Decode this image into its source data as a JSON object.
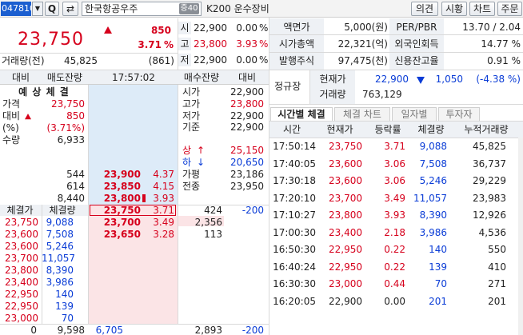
{
  "toolbar": {
    "code": "047810",
    "name": "한국항공우주",
    "badge": "증40",
    "index_label": "K200 운수장비",
    "btn_opinion": "의견",
    "btn_quote": "시황",
    "btn_chart": "차트",
    "btn_order": "주문",
    "search_glyph": "Q",
    "refresh_glyph": "⇄"
  },
  "summary": {
    "price": "23,750",
    "change": "850",
    "change_pct": "3.71",
    "pct_sign": "%",
    "volume_label": "거래량(전)",
    "volume": "45,825",
    "volume_prev": "(861)",
    "ohl": [
      {
        "label": "시",
        "value": "22,900",
        "pct": "0.00",
        "unit": "%"
      },
      {
        "label": "고",
        "value": "23,800",
        "pct": "3.93",
        "unit": "%"
      },
      {
        "label": "저",
        "value": "22,900",
        "pct": "0.00",
        "unit": "%"
      }
    ]
  },
  "info": {
    "rows": [
      {
        "l1": "액면가",
        "v1": "5,000(원)",
        "l2": "PER/PBR",
        "v2": "13.70 / 2.04"
      },
      {
        "l1": "시가총액",
        "v1": "22,321(억)",
        "l2": "외국인회득",
        "v2": "14.77 %"
      },
      {
        "l1": "발행주식",
        "v1": "97,475(천)",
        "l2": "신용잔고율",
        "v2": "0.91 %"
      }
    ],
    "regular_label": "정규장",
    "cur_label": "현재가",
    "cur_value": "22,900",
    "cur_change": "1,050",
    "cur_pct": "(-4.38 %)",
    "vol_label": "거래량",
    "vol_value": "763,129"
  },
  "orderbook": {
    "header": {
      "h1": "대비",
      "h2": "매도잔량",
      "time": "17:57:02",
      "h3": "매수잔량",
      "h4": "대비"
    },
    "expected": {
      "title": "예 상 체 결",
      "rows": [
        {
          "label": "가격",
          "value": "23,750"
        },
        {
          "label": "대비",
          "value": "850"
        },
        {
          "label": "(%)",
          "value": "(3.71%)"
        },
        {
          "label": "수량",
          "value": "6,933"
        }
      ]
    },
    "right_stats": [
      {
        "label": "시가",
        "value": "22,900"
      },
      {
        "label": "고가",
        "value": "23,800"
      },
      {
        "label": "저가",
        "value": "22,900"
      },
      {
        "label": "기준",
        "value": "22,900"
      }
    ],
    "limits": [
      {
        "label": "상",
        "arrow": "↑",
        "value": "25,150"
      },
      {
        "label": "하",
        "arrow": "↓",
        "value": "20,650"
      },
      {
        "label": "가평",
        "arrow": "",
        "value": "23,186"
      },
      {
        "label": "전종",
        "arrow": "",
        "value": "23,950"
      }
    ],
    "asks": [
      {
        "qty": "544",
        "price": "23,900",
        "pct": "4.37"
      },
      {
        "qty": "614",
        "price": "23,850",
        "pct": "4.15"
      },
      {
        "qty": "8,440",
        "price": "23,800",
        "pct": "3.93"
      }
    ],
    "bids": [
      {
        "price": "23,750",
        "pct": "3.71",
        "qty": "424",
        "diff": "-200"
      },
      {
        "price": "23,700",
        "pct": "3.49",
        "qty": "2,356",
        "diff": ""
      },
      {
        "price": "23,650",
        "pct": "3.28",
        "qty": "113",
        "diff": ""
      }
    ],
    "ticks_header": {
      "price": "체결가",
      "qty": "체결량"
    },
    "ticks": [
      {
        "price": "23,750",
        "qty": "9,088"
      },
      {
        "price": "23,600",
        "qty": "7,508"
      },
      {
        "price": "23,600",
        "qty": "5,246"
      },
      {
        "price": "23,700",
        "qty": "11,057"
      },
      {
        "price": "23,800",
        "qty": "8,390"
      },
      {
        "price": "23,400",
        "qty": "3,986"
      },
      {
        "price": "22,950",
        "qty": "140"
      },
      {
        "price": "22,950",
        "qty": "139"
      },
      {
        "price": "23,000",
        "qty": "70"
      }
    ],
    "footer": {
      "f1": "0",
      "f2": "9,598",
      "f3": "6,705",
      "f4": "2,893",
      "f5": "-200"
    }
  },
  "timetable": {
    "tabs": [
      "시간별 체결",
      "체결 차트",
      "일자별",
      "투자자"
    ],
    "columns": [
      "시간",
      "현재가",
      "등락률",
      "체결량",
      "누적거래량"
    ],
    "rows": [
      {
        "t": "17:50:14",
        "p": "23,750",
        "r": "3.71",
        "q": "9,088",
        "c": "45,825"
      },
      {
        "t": "17:40:05",
        "p": "23,600",
        "r": "3.06",
        "q": "7,508",
        "c": "36,737"
      },
      {
        "t": "17:30:18",
        "p": "23,600",
        "r": "3.06",
        "q": "5,246",
        "c": "29,229"
      },
      {
        "t": "17:20:10",
        "p": "23,700",
        "r": "3.49",
        "q": "11,057",
        "c": "23,983"
      },
      {
        "t": "17:10:27",
        "p": "23,800",
        "r": "3.93",
        "q": "8,390",
        "c": "12,926"
      },
      {
        "t": "17:00:30",
        "p": "23,400",
        "r": "2.18",
        "q": "3,986",
        "c": "4,536"
      },
      {
        "t": "16:50:30",
        "p": "22,950",
        "r": "0.22",
        "q": "140",
        "c": "550"
      },
      {
        "t": "16:40:24",
        "p": "22,950",
        "r": "0.22",
        "q": "139",
        "c": "410"
      },
      {
        "t": "16:30:30",
        "p": "23,000",
        "r": "0.44",
        "q": "70",
        "c": "271"
      },
      {
        "t": "16:20:05",
        "p": "22,900",
        "r": "0.00",
        "q": "201",
        "c": "201"
      }
    ]
  }
}
